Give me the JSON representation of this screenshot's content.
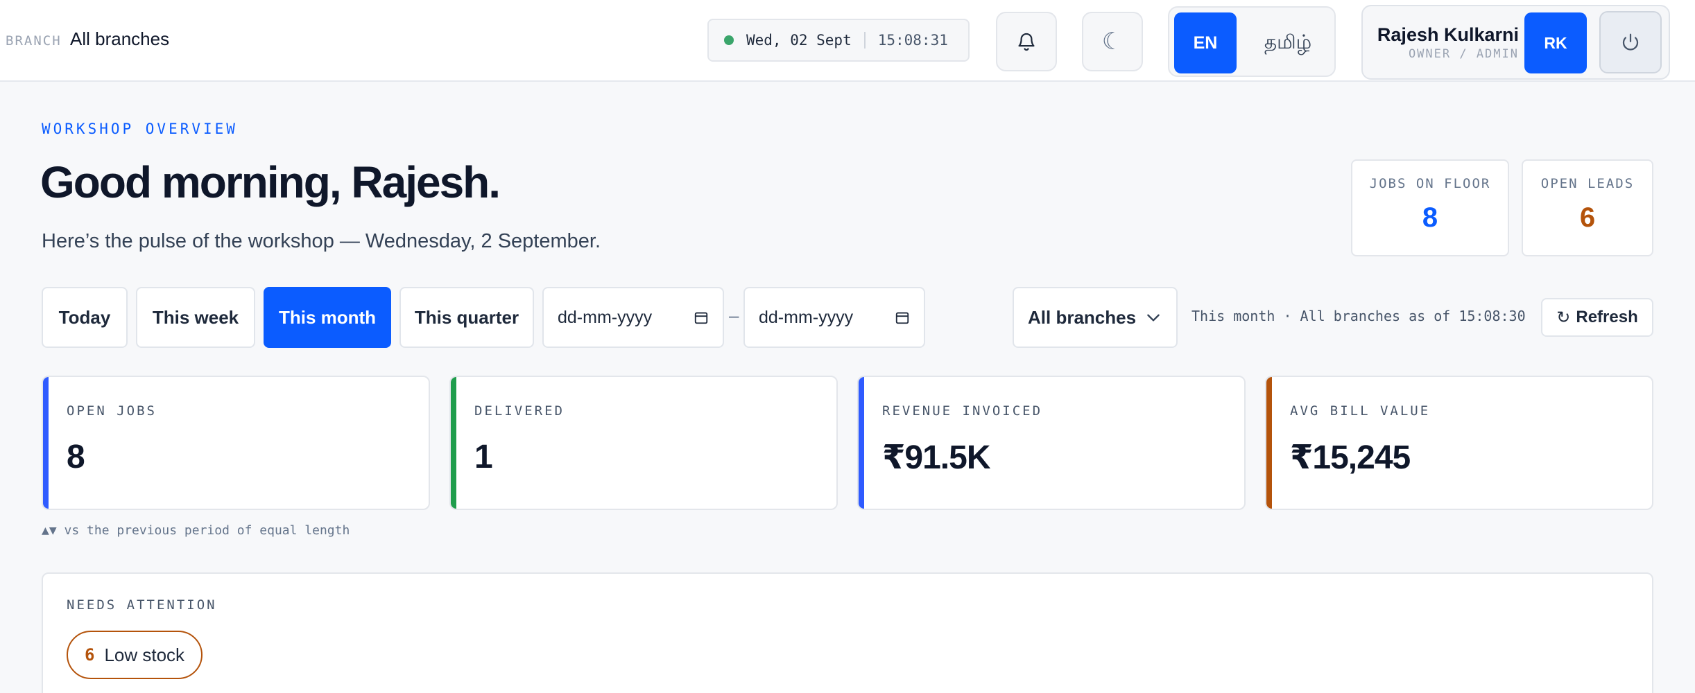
{
  "header": {
    "branch_label": "BRANCH",
    "branch_value": "All branches",
    "clock_date": "Wed, 02 Sept",
    "clock_time": "15:08:31",
    "lang_en": "EN",
    "lang_ta": "தமிழ்",
    "user_name": "Rajesh Kulkarni",
    "user_role": "OWNER / ADMIN",
    "avatar_initials": "RK"
  },
  "hero": {
    "eyebrow": "WORKSHOP OVERVIEW",
    "greeting": "Good morning, Rajesh.",
    "pulse": "Here’s the pulse of the workshop — Wednesday, 2 September."
  },
  "stats": {
    "jobs_on_floor_label": "JOBS ON FLOOR",
    "jobs_on_floor_value": "8",
    "open_leads_label": "OPEN LEADS",
    "open_leads_value": "6"
  },
  "filters": {
    "today": "Today",
    "this_week": "This week",
    "this_month": "This month",
    "this_quarter": "This quarter",
    "date_from_placeholder": "dd-mm-yyyy",
    "date_to_placeholder": "dd-mm-yyyy",
    "date_separator": "–",
    "branch_select": "All branches",
    "range_note": "This month · All branches  as of 15:08:30",
    "refresh": "Refresh"
  },
  "kpis": [
    {
      "label": "OPEN JOBS",
      "value": "8",
      "accent": "#2f5bff"
    },
    {
      "label": "DELIVERED",
      "value": "1",
      "accent": "#1f9d4c"
    },
    {
      "label": "REVENUE INVOICED",
      "value": "₹91.5K",
      "accent": "#2f5bff"
    },
    {
      "label": "AVG BILL VALUE",
      "value": "₹15,245",
      "accent": "#b4530b"
    }
  ],
  "kpi_footnote": "▲▼ vs the previous period of equal length",
  "attention": {
    "label": "NEEDS ATTENTION",
    "chips": [
      {
        "count": "6",
        "label": "Low stock"
      }
    ]
  },
  "colors": {
    "primary": "#0b5cff",
    "warning": "#b4530b",
    "success": "#1f9d4c",
    "status_dot": "#3aa56b"
  },
  "icons": {
    "bell": "bell-icon",
    "moon": "moon-icon",
    "power": "power-icon",
    "calendar": "calendar-icon",
    "chevron": "chevron-down-icon",
    "refresh": "refresh-icon"
  }
}
